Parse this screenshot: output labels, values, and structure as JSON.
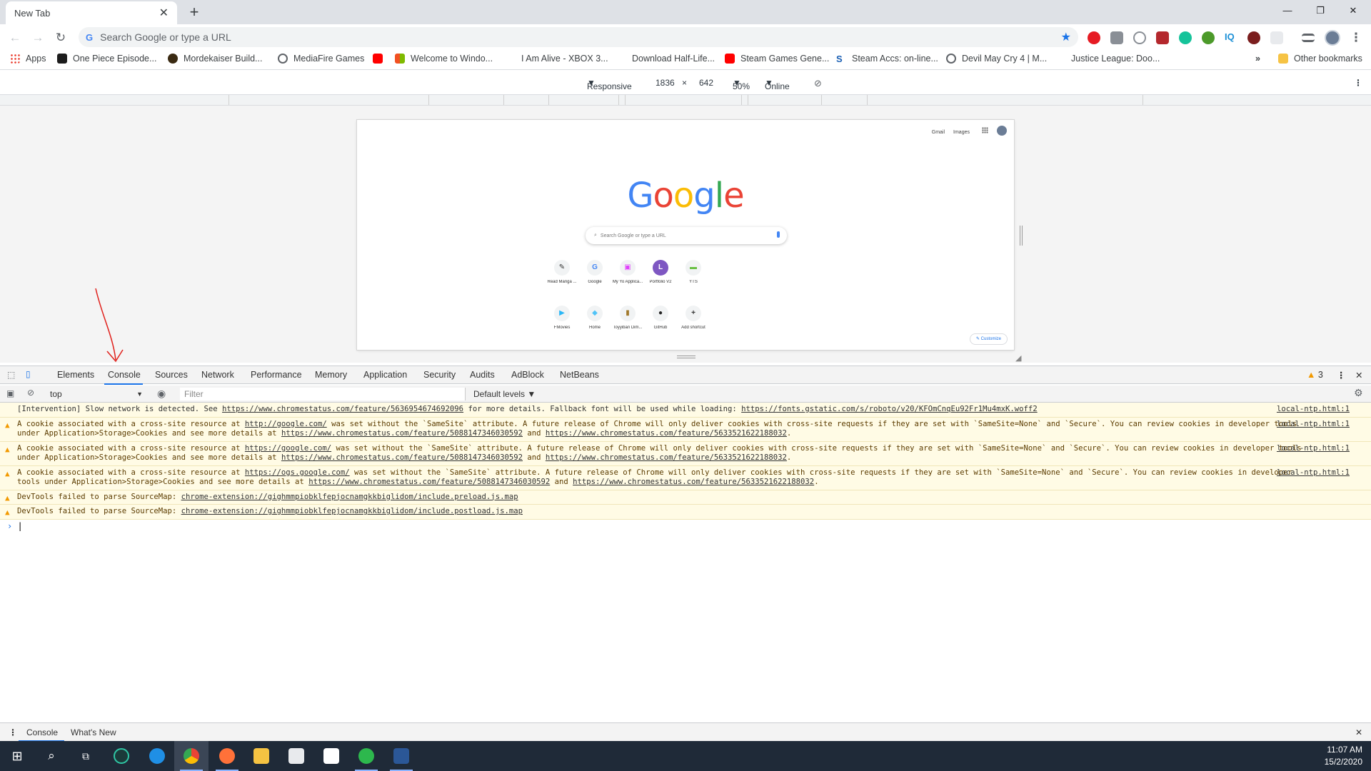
{
  "browser": {
    "tab_title": "New Tab",
    "omnibox_placeholder": "Search Google or type a URL"
  },
  "bookmarks": [
    "Apps",
    "One Piece Episode...",
    "Mordekaiser Build...",
    "MediaFire Games",
    "Welcome to Windo...",
    "I Am Alive - XBOX 3...",
    "Download Half-Life...",
    "Steam Games Gene...",
    "Steam Accs: on-line...",
    "Devil May Cry 4 | M...",
    "Justice League: Doo...",
    "Other bookmarks"
  ],
  "device_toolbar": {
    "mode": "Responsive",
    "width": "1836",
    "height": "642",
    "zoom": "50%",
    "network": "Online"
  },
  "emulated_page": {
    "gmail": "Gmail",
    "images": "Images",
    "logo": [
      "G",
      "o",
      "o",
      "g",
      "l",
      "e"
    ],
    "logo_colors": [
      "#4285f4",
      "#ea4335",
      "#fbbc05",
      "#4285f4",
      "#34a853",
      "#ea4335"
    ],
    "search_placeholder": "Search Google or type a URL",
    "tiles": [
      {
        "label": "Read Manga ...",
        "glyph": "✎",
        "color": "#333333"
      },
      {
        "label": "Google",
        "glyph": "G",
        "color": "#4285f4"
      },
      {
        "label": "My Yo Applica...",
        "glyph": "▣",
        "color": "#e040fb"
      },
      {
        "label": "Portfolio V2",
        "glyph": "L",
        "color": "#ffffff"
      },
      {
        "label": "YTS",
        "glyph": "▬",
        "color": "#6ac045"
      },
      {
        "label": "FMovies",
        "glyph": "▶",
        "color": "#29b6f6"
      },
      {
        "label": "Home",
        "glyph": "◆",
        "color": "#4fc3f7"
      },
      {
        "label": "Toyyiban Dim...",
        "glyph": "▮",
        "color": "#a0782a"
      },
      {
        "label": "GitHub",
        "glyph": "●",
        "color": "#222222"
      },
      {
        "label": "Add shortcut",
        "glyph": "+",
        "color": "#333333"
      }
    ],
    "customize": "Customize"
  },
  "devtools": {
    "tabs": [
      "Elements",
      "Console",
      "Sources",
      "Network",
      "Performance",
      "Memory",
      "Application",
      "Security",
      "Audits",
      "AdBlock",
      "NetBeans"
    ],
    "warning_count": "3",
    "context": "top",
    "filter_placeholder": "Filter",
    "levels": "Default levels ▼",
    "messages": [
      {
        "type": "intervention",
        "html_text": "[Intervention] Slow network is detected. See <u>https://www.chromestatus.com/feature/5636954674692096</u> for more details. Fallback font will be used while loading: <u>https://fonts.gstatic.com/s/roboto/v20/KFOmCnqEu92Fr1Mu4mxK.woff2</u>",
        "source": "local-ntp.html:1"
      },
      {
        "type": "warn",
        "html_text": "A cookie associated with a cross-site resource at <u>http://google.com/</u> was set without the `SameSite` attribute. A future release of Chrome will only deliver cookies with cross-site requests if they are set with `SameSite=None` and `Secure`. You can review cookies in developer tools under Application&gt;Storage&gt;Cookies and see more details at <u>https://www.chromestatus.com/feature/5088147346030592</u> and <u>https://www.chromestatus.com/feature/5633521622188032</u>.",
        "source": "local-ntp.html:1"
      },
      {
        "type": "warn",
        "html_text": "A cookie associated with a cross-site resource at <u>https://google.com/</u> was set without the `SameSite` attribute. A future release of Chrome will only deliver cookies with cross-site requests if they are set with `SameSite=None` and `Secure`. You can review cookies in developer tools under Application&gt;Storage&gt;Cookies and see more details at <u>https://www.chromestatus.com/feature/5088147346030592</u> and <u>https://www.chromestatus.com/feature/5633521622188032</u>.",
        "source": "local-ntp.html:1"
      },
      {
        "type": "warn",
        "html_text": "A cookie associated with a cross-site resource at <u>https://ogs.google.com/</u> was set without the `SameSite` attribute. A future release of Chrome will only deliver cookies with cross-site requests if they are set with `SameSite=None` and `Secure`. You can review cookies in developer tools under Application&gt;Storage&gt;Cookies and see more details at <u>https://www.chromestatus.com/feature/5088147346030592</u> and <u>https://www.chromestatus.com/feature/5633521622188032</u>.",
        "source": "local-ntp.html:1"
      },
      {
        "type": "warn",
        "html_text": "DevTools failed to parse SourceMap: <u>chrome-extension://gighmmpiobklfepjocnamgkkbiglidom/include.preload.js.map</u>",
        "source": ""
      },
      {
        "type": "warn",
        "html_text": "DevTools failed to parse SourceMap: <u>chrome-extension://gighmmpiobklfepjocnamgkkbiglidom/include.postload.js.map</u>",
        "source": ""
      }
    ],
    "drawer_tabs": [
      "Console",
      "What's New"
    ]
  },
  "taskbar": {
    "time": "11:07 AM",
    "date": "15/2/2020"
  },
  "colors": {
    "accent": "#1a73e8",
    "annotation_arrow": "#e0201b",
    "warning": "#f29900"
  }
}
